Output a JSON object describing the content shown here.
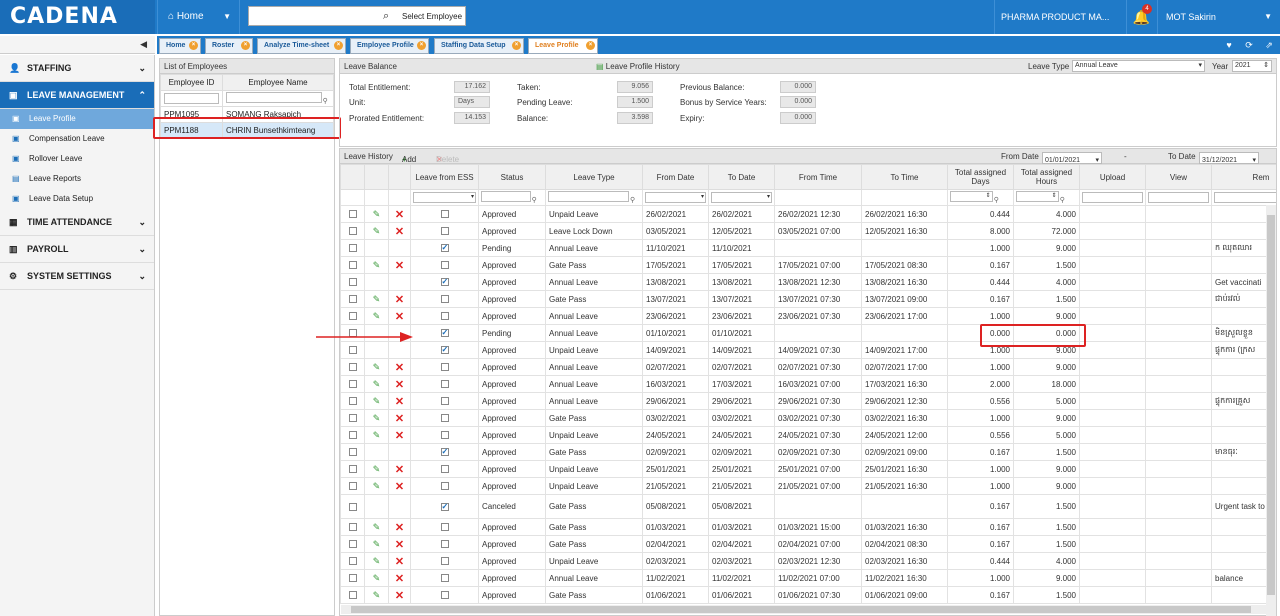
{
  "header": {
    "logo": "CADENA",
    "home_label": "Home",
    "search_placeholder": "Select Employee",
    "company": "PHARMA PRODUCT MA...",
    "notification_count": "4",
    "user": "MOT Sakirin"
  },
  "tabs": [
    {
      "label": "Home"
    },
    {
      "label": "Roster"
    },
    {
      "label": "Analyze Time-sheet"
    },
    {
      "label": "Employee Profile"
    },
    {
      "label": "Staffing Data Setup"
    },
    {
      "label": "Leave Profile"
    }
  ],
  "sidebar": {
    "staffing": "STAFFING",
    "leave_management": "LEAVE MANAGEMENT",
    "leave_items": [
      "Leave Profile",
      "Compensation Leave",
      "Rollover Leave",
      "Leave Reports",
      "Leave Data Setup"
    ],
    "time_attendance": "TIME ATTENDANCE",
    "payroll": "PAYROLL",
    "system_settings": "SYSTEM SETTINGS"
  },
  "employees": {
    "title": "List of Employees",
    "col_id": "Employee ID",
    "col_name": "Employee Name",
    "rows": [
      {
        "id": "PPM1095",
        "name": "SOMANG Raksapich"
      },
      {
        "id": "PPM1188",
        "name": "CHRIN Bunsethkimteang"
      }
    ]
  },
  "balance": {
    "title": "Leave Balance",
    "history_link": "Leave Profile History",
    "leave_type_label": "Leave Type",
    "leave_type_value": "Annual Leave",
    "year_label": "Year",
    "year_value": "2021",
    "total_entitlement_label": "Total Entitlement:",
    "total_entitlement": "17.162",
    "unit_label": "Unit:",
    "unit": "Days",
    "prorated_label": "Prorated Entitlement:",
    "prorated": "14.153",
    "taken_label": "Taken:",
    "taken": "9.056",
    "pending_label": "Pending Leave:",
    "pending": "1.500",
    "balance_label": "Balance:",
    "balance": "3.598",
    "prev_label": "Previous Balance:",
    "prev": "0.000",
    "bonus_label": "Bonus by Service Years:",
    "bonus": "0.000",
    "expiry_label": "Expiry:",
    "expiry": "0.000"
  },
  "history": {
    "title": "Leave History",
    "add": "Add",
    "delete": "Delete",
    "from_date_label": "From Date",
    "from_date": "01/01/2021",
    "dash": "-",
    "to_date_label": "To Date",
    "to_date": "31/12/2021",
    "cols": [
      "Leave from ESS",
      "Status",
      "Leave Type",
      "From Date",
      "To Date",
      "From Time",
      "To Time",
      "Total assigned Days",
      "Total assigned Hours",
      "Upload",
      "View",
      "Rem"
    ],
    "rows": [
      {
        "ed": true,
        "ess": false,
        "status": "Approved",
        "type": "Unpaid Leave",
        "fd": "26/02/2021",
        "td": "26/02/2021",
        "ft": "26/02/2021 12:30",
        "tt": "26/02/2021 16:30",
        "days": "0.444",
        "hours": "4.000",
        "rem": ""
      },
      {
        "ed": true,
        "ess": false,
        "status": "Approved",
        "type": "Leave Lock Down",
        "fd": "03/05/2021",
        "td": "12/05/2021",
        "ft": "03/05/2021 07:00",
        "tt": "12/05/2021 16:30",
        "days": "8.000",
        "hours": "72.000",
        "rem": ""
      },
      {
        "ed": false,
        "ess": true,
        "status": "Pending",
        "type": "Annual Leave",
        "fd": "11/10/2021",
        "td": "11/10/2021",
        "ft": "",
        "tt": "",
        "days": "1.000",
        "hours": "9.000",
        "rem": "ក ឈុតឈារ"
      },
      {
        "ed": true,
        "ess": false,
        "status": "Approved",
        "type": "Gate Pass",
        "fd": "17/05/2021",
        "td": "17/05/2021",
        "ft": "17/05/2021 07:00",
        "tt": "17/05/2021 08:30",
        "days": "0.167",
        "hours": "1.500",
        "rem": ""
      },
      {
        "ed": false,
        "ess": true,
        "status": "Approved",
        "type": "Annual Leave",
        "fd": "13/08/2021",
        "td": "13/08/2021",
        "ft": "13/08/2021 12:30",
        "tt": "13/08/2021 16:30",
        "days": "0.444",
        "hours": "4.000",
        "rem": "Get vaccinati"
      },
      {
        "ed": true,
        "ess": false,
        "status": "Approved",
        "type": "Gate Pass",
        "fd": "13/07/2021",
        "td": "13/07/2021",
        "ft": "13/07/2021 07:30",
        "tt": "13/07/2021 09:00",
        "days": "0.167",
        "hours": "1.500",
        "rem": "ជាប់រវល់"
      },
      {
        "ed": true,
        "ess": false,
        "status": "Approved",
        "type": "Annual Leave",
        "fd": "23/06/2021",
        "td": "23/06/2021",
        "ft": "23/06/2021 07:30",
        "tt": "23/06/2021 17:00",
        "days": "1.000",
        "hours": "9.000",
        "rem": ""
      },
      {
        "ed": false,
        "ess": true,
        "status": "Pending",
        "type": "Annual Leave",
        "fd": "01/10/2021",
        "td": "01/10/2021",
        "ft": "",
        "tt": "",
        "days": "0.000",
        "hours": "0.000",
        "rem": "មិនស្រួលខ្លួន"
      },
      {
        "ed": false,
        "ess": true,
        "status": "Approved",
        "type": "Unpaid Leave",
        "fd": "14/09/2021",
        "td": "14/09/2021",
        "ft": "14/09/2021 07:30",
        "tt": "14/09/2021 17:00",
        "days": "1.000",
        "hours": "9.000",
        "rem": "ផ្ទុកការ (ក្រស"
      },
      {
        "ed": true,
        "ess": false,
        "status": "Approved",
        "type": "Annual Leave",
        "fd": "02/07/2021",
        "td": "02/07/2021",
        "ft": "02/07/2021 07:30",
        "tt": "02/07/2021 17:00",
        "days": "1.000",
        "hours": "9.000",
        "rem": ""
      },
      {
        "ed": true,
        "ess": false,
        "status": "Approved",
        "type": "Annual Leave",
        "fd": "16/03/2021",
        "td": "17/03/2021",
        "ft": "16/03/2021 07:00",
        "tt": "17/03/2021 16:30",
        "days": "2.000",
        "hours": "18.000",
        "rem": ""
      },
      {
        "ed": true,
        "ess": false,
        "status": "Approved",
        "type": "Annual Leave",
        "fd": "29/06/2021",
        "td": "29/06/2021",
        "ft": "29/06/2021 07:30",
        "tt": "29/06/2021 12:30",
        "days": "0.556",
        "hours": "5.000",
        "rem": "ផ្ទុកការគ្រួស"
      },
      {
        "ed": true,
        "ess": false,
        "status": "Approved",
        "type": "Gate Pass",
        "fd": "03/02/2021",
        "td": "03/02/2021",
        "ft": "03/02/2021 07:30",
        "tt": "03/02/2021 16:30",
        "days": "1.000",
        "hours": "9.000",
        "rem": ""
      },
      {
        "ed": true,
        "ess": false,
        "status": "Approved",
        "type": "Unpaid Leave",
        "fd": "24/05/2021",
        "td": "24/05/2021",
        "ft": "24/05/2021 07:30",
        "tt": "24/05/2021 12:00",
        "days": "0.556",
        "hours": "5.000",
        "rem": ""
      },
      {
        "ed": false,
        "ess": true,
        "status": "Approved",
        "type": "Gate Pass",
        "fd": "02/09/2021",
        "td": "02/09/2021",
        "ft": "02/09/2021 07:30",
        "tt": "02/09/2021 09:00",
        "days": "0.167",
        "hours": "1.500",
        "rem": "មានធុរៈ"
      },
      {
        "ed": true,
        "ess": false,
        "status": "Approved",
        "type": "Unpaid Leave",
        "fd": "25/01/2021",
        "td": "25/01/2021",
        "ft": "25/01/2021 07:00",
        "tt": "25/01/2021 16:30",
        "days": "1.000",
        "hours": "9.000",
        "rem": ""
      },
      {
        "ed": true,
        "ess": false,
        "status": "Approved",
        "type": "Unpaid Leave",
        "fd": "21/05/2021",
        "td": "21/05/2021",
        "ft": "21/05/2021 07:00",
        "tt": "21/05/2021 16:30",
        "days": "1.000",
        "hours": "9.000",
        "rem": ""
      },
      {
        "ed": false,
        "ess": true,
        "status": "Canceled",
        "type": "Gate Pass",
        "fd": "05/08/2021",
        "td": "05/08/2021",
        "ft": "",
        "tt": "",
        "days": "0.167",
        "hours": "1.500",
        "rem": "Urgent task to home",
        "tall": true
      },
      {
        "ed": true,
        "ess": false,
        "status": "Approved",
        "type": "Gate Pass",
        "fd": "01/03/2021",
        "td": "01/03/2021",
        "ft": "01/03/2021 15:00",
        "tt": "01/03/2021 16:30",
        "days": "0.167",
        "hours": "1.500",
        "rem": ""
      },
      {
        "ed": true,
        "ess": false,
        "status": "Approved",
        "type": "Gate Pass",
        "fd": "02/04/2021",
        "td": "02/04/2021",
        "ft": "02/04/2021 07:00",
        "tt": "02/04/2021 08:30",
        "days": "0.167",
        "hours": "1.500",
        "rem": ""
      },
      {
        "ed": true,
        "ess": false,
        "status": "Approved",
        "type": "Unpaid Leave",
        "fd": "02/03/2021",
        "td": "02/03/2021",
        "ft": "02/03/2021 12:30",
        "tt": "02/03/2021 16:30",
        "days": "0.444",
        "hours": "4.000",
        "rem": ""
      },
      {
        "ed": true,
        "ess": false,
        "status": "Approved",
        "type": "Annual Leave",
        "fd": "11/02/2021",
        "td": "11/02/2021",
        "ft": "11/02/2021 07:00",
        "tt": "11/02/2021 16:30",
        "days": "1.000",
        "hours": "9.000",
        "rem": "balance"
      },
      {
        "ed": true,
        "ess": false,
        "status": "Approved",
        "type": "Gate Pass",
        "fd": "01/06/2021",
        "td": "01/06/2021",
        "ft": "01/06/2021 07:30",
        "tt": "01/06/2021 09:00",
        "days": "0.167",
        "hours": "1.500",
        "rem": ""
      }
    ]
  },
  "colors": {
    "primary": "#1f7ac8",
    "highlight": "#d22222"
  }
}
